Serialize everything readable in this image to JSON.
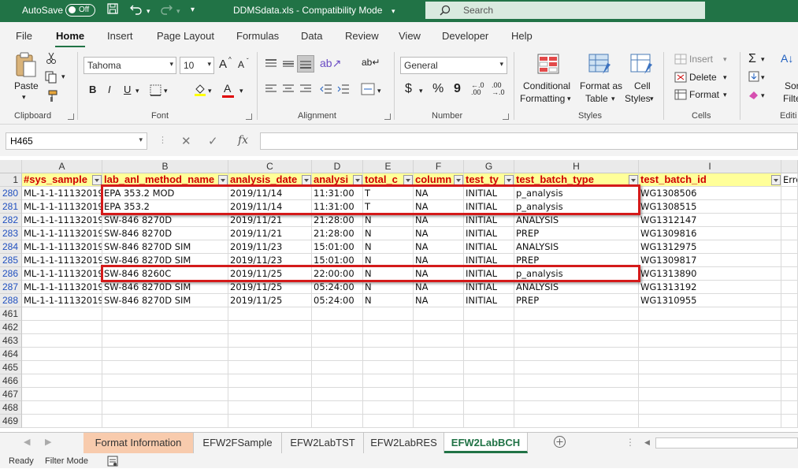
{
  "titlebar": {
    "autosave_label": "AutoSave",
    "autosave_state": "Off",
    "document_title": "DDMSdata.xls - Compatibility Mode",
    "search_placeholder": "Search"
  },
  "menu": [
    "File",
    "Home",
    "Insert",
    "Page Layout",
    "Formulas",
    "Data",
    "Review",
    "View",
    "Developer",
    "Help"
  ],
  "ribbon": {
    "clipboard": {
      "paste": "Paste",
      "label": "Clipboard"
    },
    "font": {
      "name": "Tahoma",
      "size": "10",
      "label": "Font",
      "grow": "A",
      "shrink": "A",
      "bold": "B",
      "italic": "I",
      "underline": "U",
      "font_color": "A"
    },
    "alignment": {
      "label": "Alignment"
    },
    "number": {
      "format": "General",
      "label": "Number",
      "currency": "$",
      "percent": "%",
      "comma": "9"
    },
    "styles": {
      "conditional": "Conditional",
      "conditional2": "Formatting",
      "format_as": "Format as",
      "format_as2": "Table",
      "cell": "Cell",
      "cell2": "Styles",
      "label": "Styles"
    },
    "cells": {
      "insert": "Insert",
      "delete": "Delete",
      "format": "Format",
      "label": "Cells"
    },
    "editing": {
      "sort": "Sort",
      "sort2": "Filter",
      "label": "Editi"
    }
  },
  "formula_bar": {
    "name_box": "H465",
    "fx": "fx",
    "value": ""
  },
  "columns": [
    "A",
    "B",
    "C",
    "D",
    "E",
    "F",
    "G",
    "H",
    "I"
  ],
  "header_row": {
    "row_number": "1",
    "cells": [
      "#sys_sample",
      "lab_anl_method_name",
      "analysis_date",
      "analysi",
      "total_c",
      "column",
      "test_ty",
      "test_batch_type",
      "test_batch_id",
      "Erro"
    ]
  },
  "rows": [
    {
      "num": "280",
      "cells": [
        "ML-1-1-11132019",
        "EPA 353.2 MOD",
        "2019/11/14",
        "11:31:00",
        "T",
        "NA",
        "INITIAL",
        "p_analysis",
        "WG1308506"
      ]
    },
    {
      "num": "281",
      "cells": [
        "ML-1-1-11132019",
        "EPA 353.2",
        "2019/11/14",
        "11:31:00",
        "T",
        "NA",
        "INITIAL",
        "p_analysis",
        "WG1308515"
      ]
    },
    {
      "num": "282",
      "cells": [
        "ML-1-1-11132019",
        "SW-846 8270D",
        "2019/11/21",
        "21:28:00",
        "N",
        "NA",
        "INITIAL",
        "ANALYSIS",
        "WG1312147"
      ]
    },
    {
      "num": "283",
      "cells": [
        "ML-1-1-11132019",
        "SW-846 8270D",
        "2019/11/21",
        "21:28:00",
        "N",
        "NA",
        "INITIAL",
        "PREP",
        "WG1309816"
      ]
    },
    {
      "num": "284",
      "cells": [
        "ML-1-1-11132019",
        "SW-846 8270D SIM",
        "2019/11/23",
        "15:01:00",
        "N",
        "NA",
        "INITIAL",
        "ANALYSIS",
        "WG1312975"
      ]
    },
    {
      "num": "285",
      "cells": [
        "ML-1-1-11132019",
        "SW-846 8270D SIM",
        "2019/11/23",
        "15:01:00",
        "N",
        "NA",
        "INITIAL",
        "PREP",
        "WG1309817"
      ]
    },
    {
      "num": "286",
      "cells": [
        "ML-1-1-11132019",
        "SW-846 8260C",
        "2019/11/25",
        "22:00:00",
        "N",
        "NA",
        "INITIAL",
        "p_analysis",
        "WG1313890"
      ]
    },
    {
      "num": "287",
      "cells": [
        "ML-1-1-11132019",
        "SW-846 8270D SIM",
        "2019/11/25",
        "05:24:00",
        "N",
        "NA",
        "INITIAL",
        "ANALYSIS",
        "WG1313192"
      ]
    },
    {
      "num": "288",
      "cells": [
        "ML-1-1-11132019",
        "SW-846 8270D SIM",
        "2019/11/25",
        "05:24:00",
        "N",
        "NA",
        "INITIAL",
        "PREP",
        "WG1310955"
      ]
    }
  ],
  "empty_rows": [
    "461",
    "462",
    "463",
    "464",
    "465",
    "466",
    "467",
    "468",
    "469"
  ],
  "sheet_tabs": [
    "Format Information",
    "EFW2FSample",
    "EFW2LabTST",
    "EFW2LabRES",
    "EFW2LabBCH"
  ],
  "active_tab": "EFW2LabBCH",
  "status": {
    "ready": "Ready",
    "mode": "Filter Mode"
  },
  "colors": {
    "excel_green": "#217346",
    "header_fill": "#ffff99",
    "header_text": "#d00000",
    "highlight_box": "#d41a1a",
    "filtered_row_number": "#1f4fbf"
  }
}
